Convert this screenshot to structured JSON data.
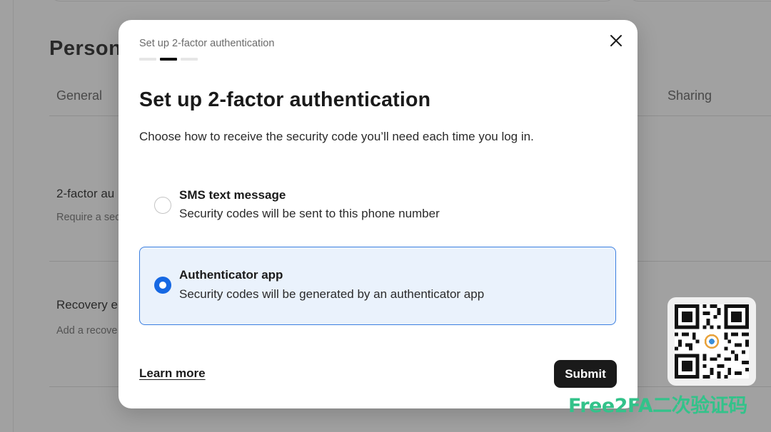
{
  "background": {
    "page_title": "Person",
    "tabs": [
      {
        "label": "General"
      },
      {
        "label": "Sharing"
      }
    ],
    "rows": [
      {
        "title": "2-factor au",
        "description": "Require a sec"
      },
      {
        "title": "Recovery e",
        "description": "Add a recove"
      }
    ]
  },
  "modal": {
    "eyebrow": "Set up 2-factor authentication",
    "steps": {
      "total": 3,
      "current": 2
    },
    "title": "Set up 2-factor authentication",
    "description": "Choose how to receive the security code you’ll need each time you log in.",
    "options": [
      {
        "title": "SMS text message",
        "description": "Security codes will be sent to this phone number",
        "selected": false
      },
      {
        "title": "Authenticator app",
        "description": "Security codes will be generated by an authenticator app",
        "selected": true
      }
    ],
    "learn_more_label": "Learn more",
    "submit_label": "Submit"
  },
  "watermark": {
    "text": "Free2FA二次验证码"
  },
  "colors": {
    "accent": "#1668e3",
    "selected_bg": "#eaf2fc",
    "selected_border": "#3b7fe0",
    "primary_button": "#1a1a1a",
    "watermark": "#33c28a"
  }
}
